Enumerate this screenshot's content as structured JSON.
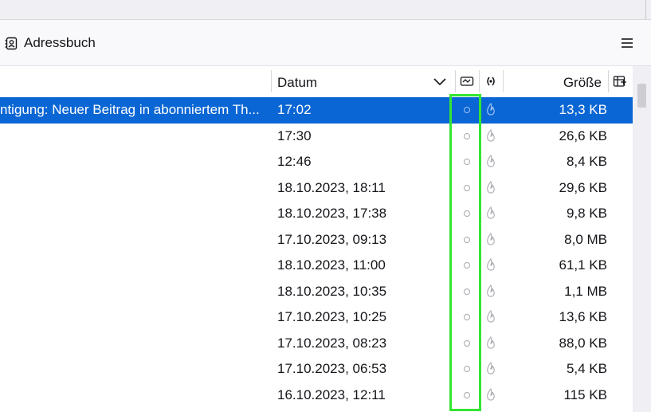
{
  "toolbar": {
    "title": "Adressbuch"
  },
  "columns": {
    "date": "Datum",
    "size": "Größe"
  },
  "rows": [
    {
      "subject": "ntigung: Neuer Beitrag in abonniertem Th...",
      "date": "17:02",
      "size": "13,3 KB",
      "selected": true
    },
    {
      "subject": "",
      "date": "17:30",
      "size": "26,6 KB",
      "selected": false
    },
    {
      "subject": "",
      "date": "12:46",
      "size": "8,4 KB",
      "selected": false
    },
    {
      "subject": "",
      "date": "18.10.2023, 18:11",
      "size": "29,6 KB",
      "selected": false
    },
    {
      "subject": "",
      "date": "18.10.2023, 17:38",
      "size": "9,8 KB",
      "selected": false
    },
    {
      "subject": "",
      "date": "17.10.2023, 09:13",
      "size": "8,0 MB",
      "selected": false
    },
    {
      "subject": "",
      "date": "18.10.2023, 11:00",
      "size": "61,1 KB",
      "selected": false
    },
    {
      "subject": "",
      "date": "18.10.2023, 10:35",
      "size": "1,1 MB",
      "selected": false
    },
    {
      "subject": "",
      "date": "17.10.2023, 10:25",
      "size": "13,6 KB",
      "selected": false
    },
    {
      "subject": "",
      "date": "17.10.2023, 08:23",
      "size": "88,0 KB",
      "selected": false
    },
    {
      "subject": "",
      "date": "17.10.2023, 06:53",
      "size": "5,4 KB",
      "selected": false
    },
    {
      "subject": "",
      "date": "16.10.2023, 12:11",
      "size": "115 KB",
      "selected": false
    }
  ],
  "colors": {
    "selection": "#0a66d4",
    "highlight_box": "#33e633"
  },
  "icons": {
    "addressbook": "address-book-icon",
    "menu": "hamburger-menu-icon",
    "junk": "junk-status-icon",
    "thread": "thread-icon",
    "picker": "column-picker-icon"
  }
}
